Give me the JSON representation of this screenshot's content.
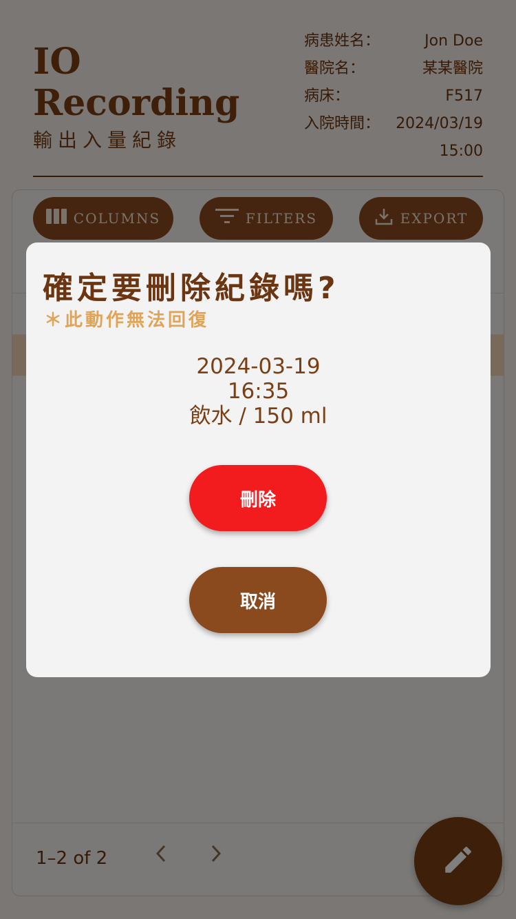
{
  "header": {
    "title_line1": "IO",
    "title_line2": "Recording",
    "subtitle": "輸出入量紀錄"
  },
  "patient": {
    "name_label": "病患姓名：",
    "name_value": "Jon Doe",
    "hospital_label": "醫院名：",
    "hospital_value": "某某醫院",
    "bed_label": "病床：",
    "bed_value": "F517",
    "admission_label": "入院時間：",
    "admission_date": "2024/03/19",
    "admission_time": "15:00"
  },
  "toolbar": {
    "columns_label": "COLUMNS",
    "filters_label": "FILTERS",
    "export_label": "EXPORT"
  },
  "pagination": {
    "text": "1–2 of 2"
  },
  "dialog": {
    "title": "確定要刪除紀錄嗎?",
    "warning": "＊此動作無法回復",
    "record_date": "2024-03-19",
    "record_time": "16:35",
    "record_detail": "飲水 / 150 ml",
    "delete_label": "刪除",
    "cancel_label": "取消"
  },
  "colors": {
    "primary_brown": "#8a4a1f",
    "danger_red": "#f21c1f",
    "warning_amber": "#e0a458"
  }
}
